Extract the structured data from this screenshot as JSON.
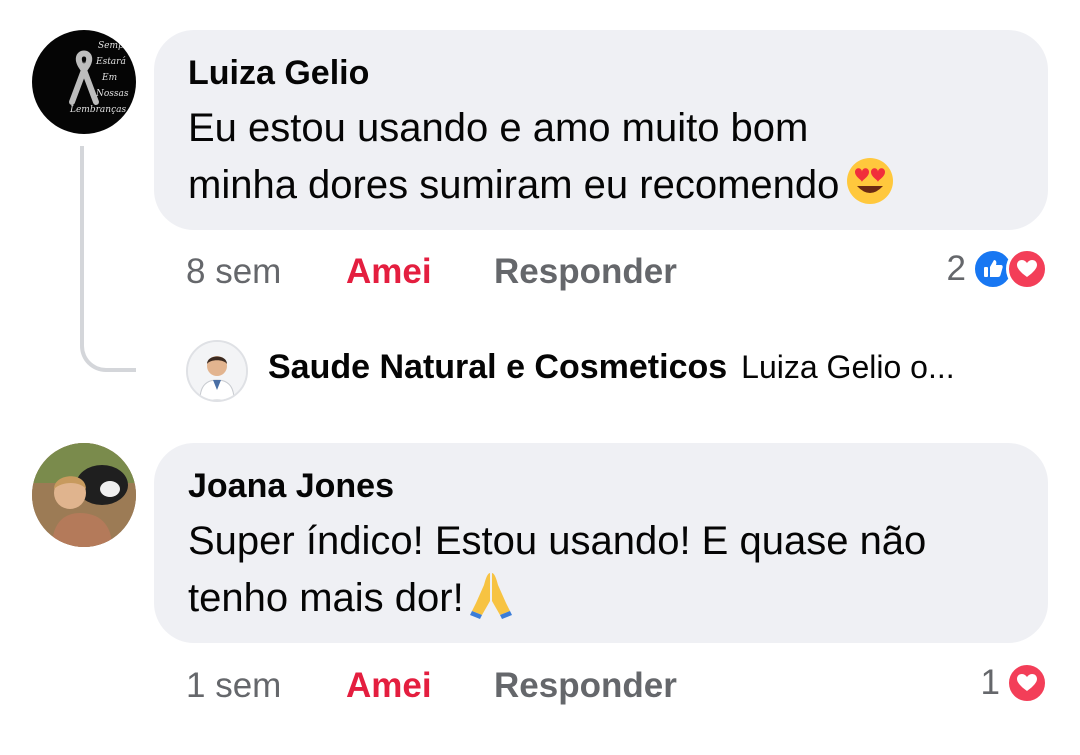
{
  "comments": [
    {
      "author": "Luiza Gelio",
      "avatar_text": [
        "Sempre",
        "Estará",
        "Em",
        "Nossas",
        "Lembranças"
      ],
      "line1": "Eu estou usando e amo muito bom",
      "line2": "minha dores sumiram eu recomendo",
      "emoji": "smiling-face-with-heart-eyes",
      "time": "8 sem",
      "love_label": "Amei",
      "reply_label": "Responder",
      "reaction_count": "2",
      "reactions": [
        "like",
        "love"
      ]
    },
    {
      "author": "Joana Jones",
      "line1": "Super índico! Estou usando! E quase não",
      "line2": "tenho mais dor!",
      "emoji": "folded-hands",
      "time": "1 sem",
      "love_label": "Amei",
      "reply_label": "Responder",
      "reaction_count": "1",
      "reactions": [
        "love"
      ]
    }
  ],
  "reply_preview": {
    "author": "Saude Natural e Cosmeticos",
    "snippet": "Luiza Gelio o..."
  },
  "colors": {
    "bubble": "#eff0f4",
    "love": "#e41e3f",
    "meta": "#65676b",
    "like": "#1877f2",
    "heart": "#f33e58"
  }
}
